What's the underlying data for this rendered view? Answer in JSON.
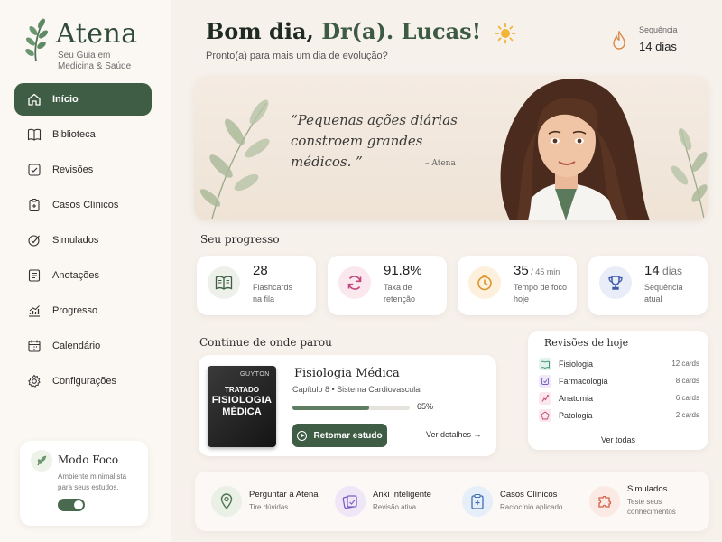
{
  "brand": {
    "name": "Atena",
    "subtitle_line1": "Seu Guia em",
    "subtitle_line2": "Medicina & Saúde"
  },
  "nav": [
    {
      "label": "Início",
      "icon": "home-icon",
      "active": true
    },
    {
      "label": "Biblioteca",
      "icon": "book-icon"
    },
    {
      "label": "Revisões",
      "icon": "check-square-icon"
    },
    {
      "label": "Casos Clínicos",
      "icon": "clipboard-icon"
    },
    {
      "label": "Simulados",
      "icon": "target-check-icon"
    },
    {
      "label": "Anotações",
      "icon": "notes-icon"
    },
    {
      "label": "Progresso",
      "icon": "chart-icon"
    },
    {
      "label": "Calendário",
      "icon": "calendar-icon"
    },
    {
      "label": "Configurações",
      "icon": "gear-icon"
    }
  ],
  "focus_mode": {
    "title": "Modo Foco",
    "desc_line1": "Ambiente minimalista",
    "desc_line2": "para seus estudos.",
    "enabled": true
  },
  "header": {
    "greeting_prefix": "Bom dia, ",
    "greeting_name": "Dr(a). Lucas!",
    "subtitle": "Pronto(a) para mais um dia de evolução?",
    "streak_label": "Sequência",
    "streak_value": "14 dias"
  },
  "banner": {
    "quote_line1": "“Pequenas ações diárias",
    "quote_line2": "constroem grandes médicos. ”",
    "author": "– Atena"
  },
  "progress": {
    "title": "Seu progresso",
    "stats": [
      {
        "value": "28",
        "suffix": "",
        "label_line1": "Flashcards",
        "label_line2": "na fila",
        "icon": "book-open-icon"
      },
      {
        "value": "91.8%",
        "suffix": "",
        "label_line1": "Taxa de",
        "label_line2": "retenção",
        "icon": "refresh-icon"
      },
      {
        "value": "35",
        "suffix": " / 45 min",
        "label_line1": "Tempo de foco",
        "label_line2": "hoje",
        "icon": "clock-icon"
      },
      {
        "value": "14",
        "suffix": " dias",
        "label_line1": "Sequência",
        "label_line2": "atual",
        "icon": "trophy-icon"
      }
    ]
  },
  "continue": {
    "title": "Continue de onde parou",
    "book_author": "GUYTON",
    "book_cover_line1": "TRATADO",
    "book_cover_line2": "FISIOLOGIA",
    "book_cover_line3": "MÉDICA",
    "book_title": "Fisiologia Médica",
    "meta": "Capítulo 8  •  Sistema Cardiovascular",
    "progress": 0.65,
    "progress_label": "65%",
    "resume_label": "Retomar estudo",
    "details_label": "Ver detalhes  →"
  },
  "reviews": {
    "title": "Revisões de hoje",
    "items": [
      {
        "name": "Fisiologia",
        "count": "12 cards",
        "color": "#2f8a6b"
      },
      {
        "name": "Farmacologia",
        "count": "8 cards",
        "color": "#7a5fc2"
      },
      {
        "name": "Anatomia",
        "count": "6 cards",
        "color": "#c2447a"
      },
      {
        "name": "Patologia",
        "count": "2 cards",
        "color": "#c2447a"
      }
    ],
    "see_all": "Ver todas"
  },
  "tools": [
    {
      "name": "Perguntar à Atena",
      "desc_line1": "Tire dúvidas",
      "desc_line2": "",
      "icon": "location-pin-icon"
    },
    {
      "name": "Anki Inteligente",
      "desc_line1": "Revisão ativa",
      "desc_line2": "",
      "icon": "cards-icon"
    },
    {
      "name": "Casos Clínicos",
      "desc_line1": "Raciocínio aplicado",
      "desc_line2": "",
      "icon": "clipboard-icon"
    },
    {
      "name": "Simulados",
      "desc_line1": "Teste seus",
      "desc_line2": "conhecimentos",
      "icon": "puzzle-icon"
    }
  ],
  "colors": {
    "accent": "#3e5d44",
    "background": "#f7f1ec",
    "card": "#ffffff"
  }
}
